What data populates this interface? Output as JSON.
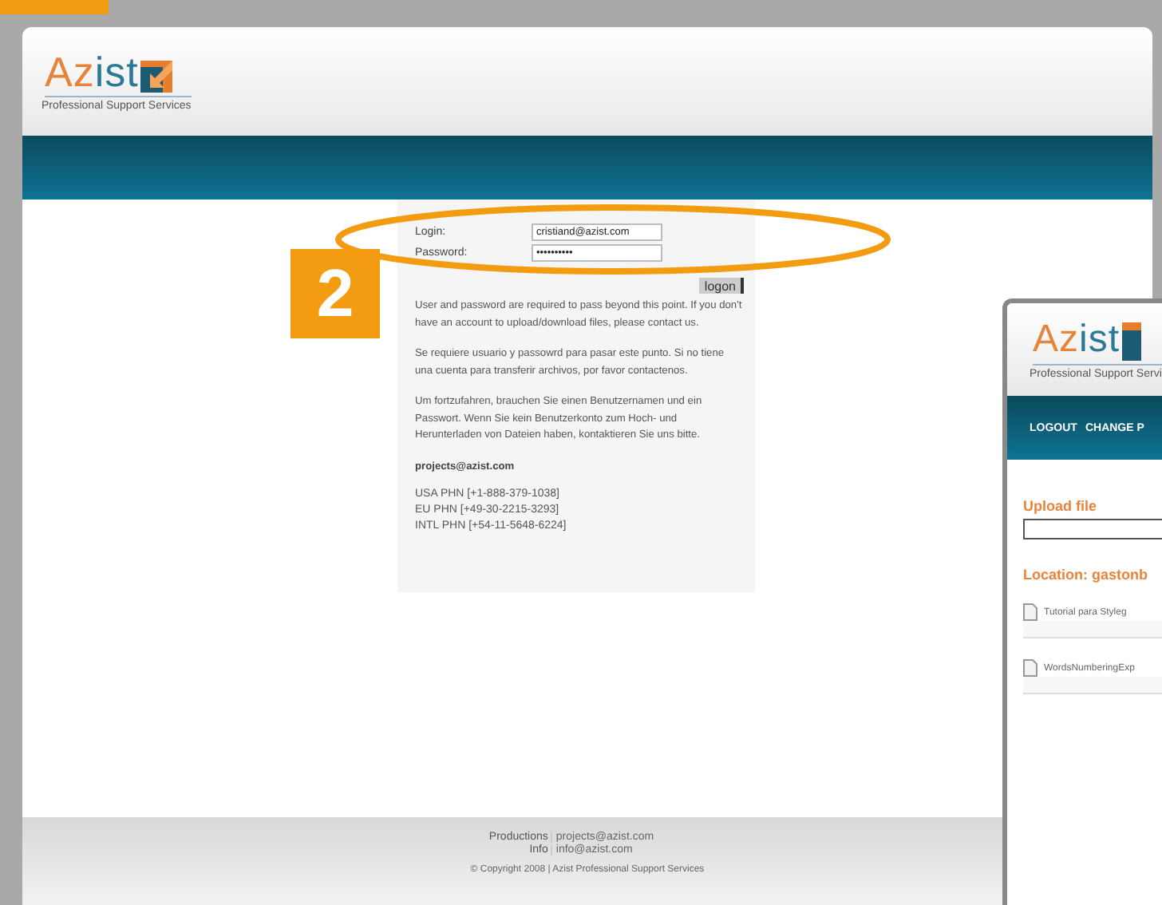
{
  "callout": {
    "number": "2"
  },
  "main_window": {
    "logo": {
      "name": "Azist",
      "tagline": "Professional Support Services"
    },
    "login_form": {
      "login_label": "Login:",
      "login_value": "cristiand@azist.com",
      "password_label": "Password:",
      "password_value": "••••••••••",
      "button": "logon"
    },
    "paragraphs": [
      "User and password are required to pass beyond this point. If you don't have an account to upload/download files, please contact us.",
      "Se requiere usuario y passowrd para pasar este punto. Si no tiene una cuenta para transferir archivos, por favor contactenos.",
      "Um fortzufahren, brauchen Sie einen Benutzernamen und ein Passwort. Wenn Sie kein Benutzerkonto zum Hoch- und Herunterladen von Dateien haben, kontaktieren Sie uns bitte."
    ],
    "contact_email": "projects@azist.com",
    "phones": [
      "USA PHN [+1-888-379-1038]",
      "EU PHN [+49-30-2215-3293]",
      "INTL PHN [+54-11-5648-6224]"
    ],
    "footer": {
      "contacts": [
        {
          "label": "Productions",
          "email": "projects@azist.com"
        },
        {
          "label": "Info",
          "email": "info@azist.com"
        }
      ],
      "copyright": "© Copyright 2008 | Azist Professional Support Services"
    }
  },
  "second_window": {
    "logo": {
      "name": "Azist",
      "tagline": "Professional Support Servi"
    },
    "nav": [
      "LOGOUT",
      "CHANGE P"
    ],
    "upload_heading": "Upload file",
    "location_heading": "Location: gastonb",
    "files": [
      "Tutorial para Styleg",
      "WordsNumberingExp"
    ]
  }
}
